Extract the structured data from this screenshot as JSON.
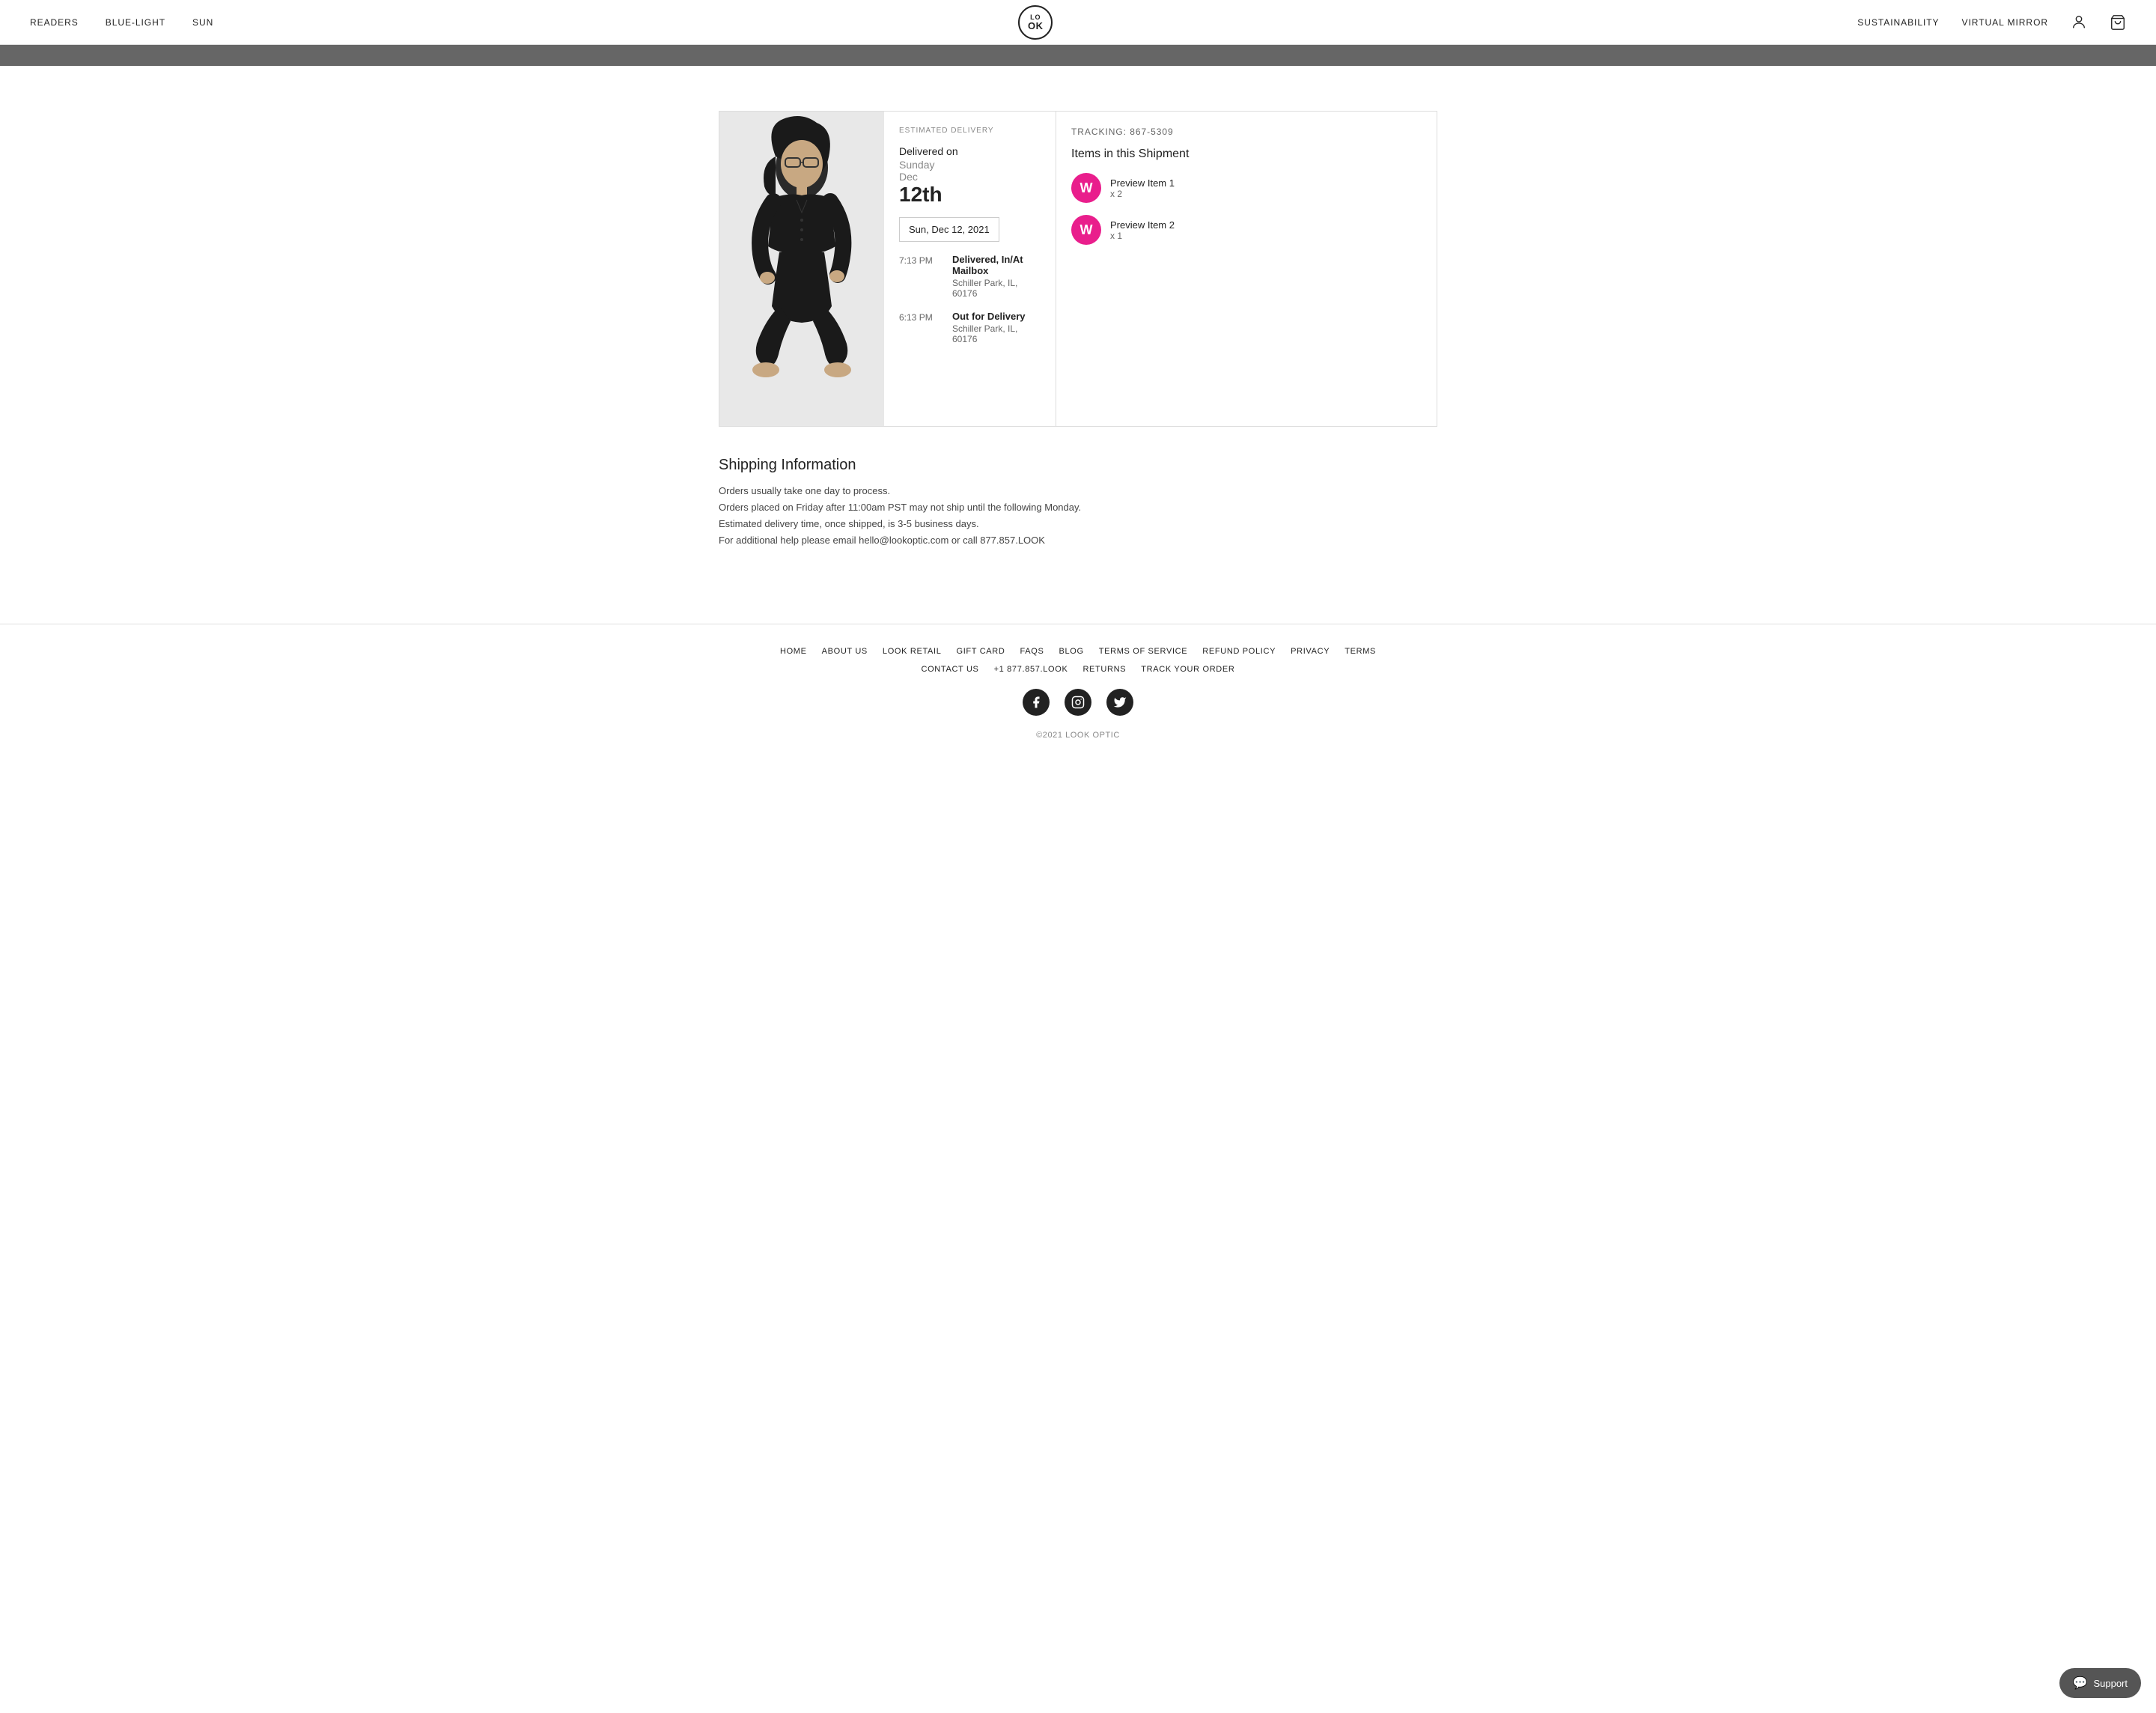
{
  "header": {
    "nav_left": [
      {
        "label": "READERS",
        "id": "nav-readers"
      },
      {
        "label": "BLUE-LIGHT",
        "id": "nav-blue-light"
      },
      {
        "label": "SUN",
        "id": "nav-sun"
      }
    ],
    "logo": {
      "top": "LO",
      "bottom": "OK",
      "full": "LOOK"
    },
    "nav_right": [
      {
        "label": "SUSTAINABILITY",
        "id": "nav-sustainability"
      },
      {
        "label": "VIRTUAL MIRROR",
        "id": "nav-virtual-mirror"
      }
    ]
  },
  "tracking": {
    "estimated_delivery_label": "ESTIMATED DELIVERY",
    "delivered_on_label": "Delivered on",
    "day": "Sunday",
    "month": "Dec",
    "date": "12th",
    "date_badge": "Sun, Dec 12, 2021",
    "tracking_label": "TRACKING: 867-5309",
    "items_title": "Items in this Shipment",
    "events": [
      {
        "time": "7:13 PM",
        "title": "Delivered, In/At Mailbox",
        "location": "Schiller Park, IL, 60176"
      },
      {
        "time": "6:13 PM",
        "title": "Out for Delivery",
        "location": "Schiller Park, IL, 60176"
      }
    ],
    "items": [
      {
        "name": "Preview Item 1",
        "qty": "x 2",
        "icon": "W"
      },
      {
        "name": "Preview Item 2",
        "qty": "x 1",
        "icon": "W"
      }
    ]
  },
  "shipping": {
    "title": "Shipping Information",
    "lines": [
      "Orders usually take one day to process.",
      "Orders placed on Friday after 11:00am PST may not ship until the following Monday.",
      "Estimated delivery time, once shipped, is 3-5 business days.",
      "For additional help please email hello@lookoptic.com or call 877.857.LOOK"
    ]
  },
  "footer": {
    "row1": [
      {
        "label": "HOME"
      },
      {
        "label": "ABOUT US"
      },
      {
        "label": "LOOK RETAIL"
      },
      {
        "label": "GIFT CARD"
      },
      {
        "label": "FAQS"
      },
      {
        "label": "BLOG"
      },
      {
        "label": "TERMS OF SERVICE"
      },
      {
        "label": "REFUND POLICY"
      },
      {
        "label": "PRIVACY"
      },
      {
        "label": "TERMS"
      }
    ],
    "row2": [
      {
        "label": "CONTACT US"
      },
      {
        "label": "+1 877.857.LOOK"
      },
      {
        "label": "RETURNS"
      },
      {
        "label": "TRACK YOUR ORDER"
      }
    ],
    "copyright": "©2021 LOOK OPTIC",
    "social": [
      {
        "name": "facebook",
        "icon": "f"
      },
      {
        "name": "instagram",
        "icon": "◻"
      },
      {
        "name": "twitter",
        "icon": "t"
      }
    ]
  },
  "support": {
    "label": "Support"
  }
}
